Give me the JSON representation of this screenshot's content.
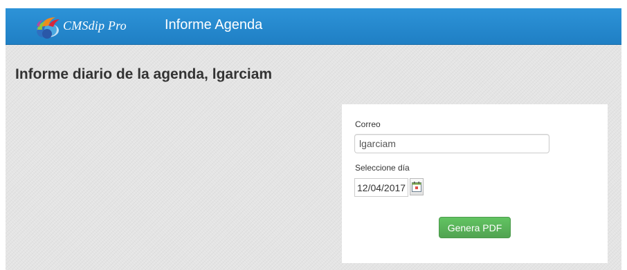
{
  "header": {
    "brand": "CMSdip Pro",
    "title": "Informe Agenda",
    "logo_icon": "cmsdip-logo",
    "color": "#2188cf"
  },
  "page": {
    "title": "Informe diario de la agenda, lgarciam"
  },
  "form": {
    "email_label": "Correo",
    "email_value": "lgarciam",
    "date_label": "Seleccione día",
    "date_value": "12/04/2017",
    "calendar_icon": "calendar-icon",
    "submit_label": "Genera PDF",
    "submit_color": "#5cb85c"
  }
}
